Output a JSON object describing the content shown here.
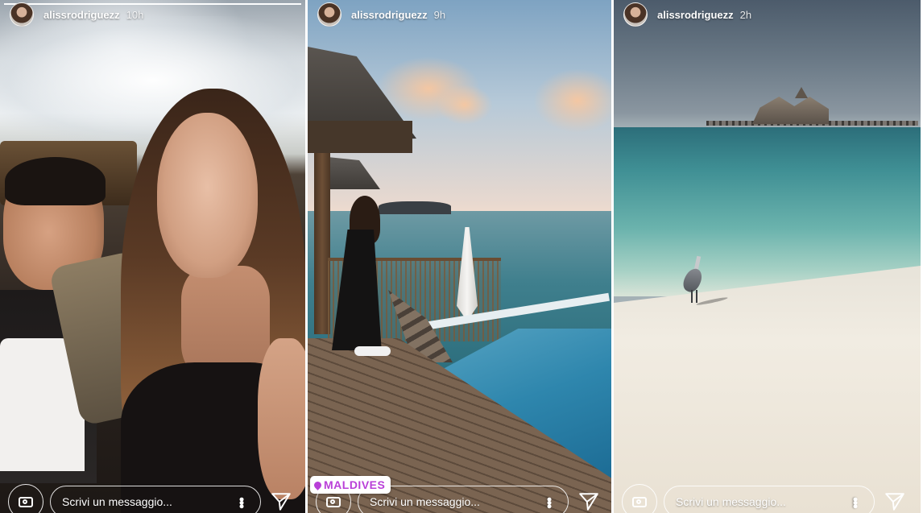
{
  "stories": [
    {
      "username": "alissrodriguezz",
      "time": "10h",
      "message_placeholder": "Scrivi un messaggio...",
      "progress": 1.0
    },
    {
      "username": "alissrodriguezz",
      "time": "9h",
      "message_placeholder": "Scrivi un messaggio...",
      "location_sticker": "MALDIVES",
      "progress": 1.0
    },
    {
      "username": "alissrodriguezz",
      "time": "2h",
      "message_placeholder": "Scrivi un messaggio...",
      "progress": 1.0
    }
  ],
  "icons": {
    "camera": "camera-icon",
    "send": "paper-plane-icon",
    "more": "vertical-dots-icon",
    "location": "pin-icon"
  },
  "colors": {
    "location_sticker_text": "#b93fd8",
    "chrome_text": "#ffffff"
  }
}
